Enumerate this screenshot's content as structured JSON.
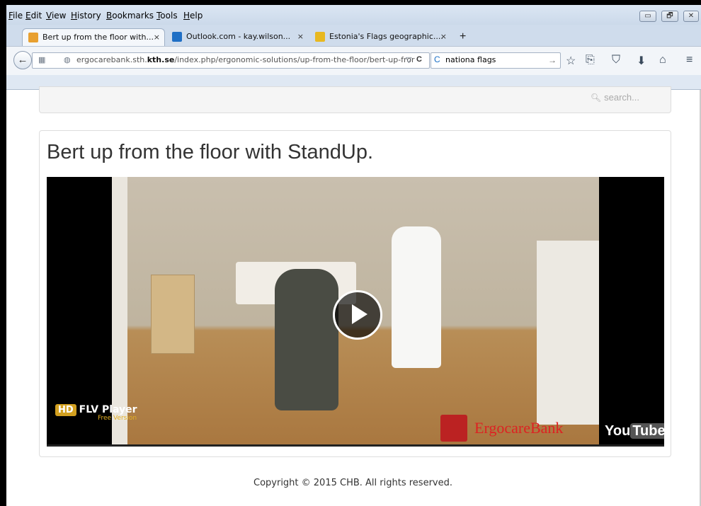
{
  "menu": [
    "File",
    "Edit",
    "View",
    "History",
    "Bookmarks",
    "Tools",
    "Help"
  ],
  "window_buttons": {
    "minimize": "▭",
    "maximize": "🗗",
    "close": "✕"
  },
  "tabs": [
    {
      "label": "Bert up from the floor with...",
      "close": "×",
      "icon_color": "#e8a030",
      "icon": "page-icon"
    },
    {
      "label": "Outlook.com - kay.wilson...",
      "close": "×",
      "icon_color": "#1f6fc5",
      "icon": "outlook-icon"
    },
    {
      "label": "Estonia's Flags geographic....",
      "close": "×",
      "icon_color": "#e8b820",
      "icon": "flag-icon"
    }
  ],
  "new_tab": "+",
  "nav": {
    "back": "←",
    "url_host_prefix": "ergocarebank.sth.",
    "url_host_bold": "kth.se",
    "url_path": "/index.php/ergonomic-solutions/up-from-the-floor/bert-up-fror",
    "url_dropdown": "▽",
    "reload": "C",
    "search_value": "nationa flags",
    "search_go": "→"
  },
  "toolbar_icons": [
    "☆",
    "⎘",
    "⛉",
    "⬇",
    "⌂",
    "≡"
  ],
  "page": {
    "search_placeholder": "search...",
    "article_title": "Bert up from the floor with StandUp.",
    "video": {
      "hd_badge": "HD",
      "player_name": "FLV Player",
      "free_version": "Free Version",
      "brand": "ErgocareBank",
      "yt_you": "You",
      "yt_tube": "Tube"
    },
    "footer": "Copyright © 2015 CHB. All rights reserved."
  }
}
